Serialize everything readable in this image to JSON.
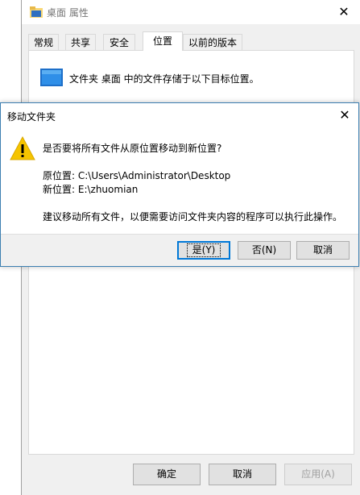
{
  "properties_window": {
    "title": "桌面 属性",
    "close_glyph": "✕",
    "tabs": [
      {
        "label": "常规"
      },
      {
        "label": "共享"
      },
      {
        "label": "安全"
      },
      {
        "label": "位置",
        "active": true
      },
      {
        "label": "以前的版本"
      }
    ],
    "location_description": "文件夹 桌面 中的文件存储于以下目标位置。",
    "buttons": {
      "ok": "确定",
      "cancel": "取消",
      "apply": "应用(A)"
    }
  },
  "move_dialog": {
    "title": "移动文件夹",
    "close_glyph": "✕",
    "question": "是否要将所有文件从原位置移动到新位置?",
    "original_location": "原位置: C:\\Users\\Administrator\\Desktop",
    "new_location": "新位置: E:\\zhuomian",
    "advice": "建议移动所有文件，以便需要访问文件夹内容的程序可以执行此操作。",
    "buttons": {
      "yes": "是(Y)",
      "no": "否(N)",
      "cancel": "取消"
    }
  },
  "colors": {
    "accent": "#0078d7",
    "dialog_border": "#3c7fb1",
    "warning_yellow": "#f5c400"
  }
}
